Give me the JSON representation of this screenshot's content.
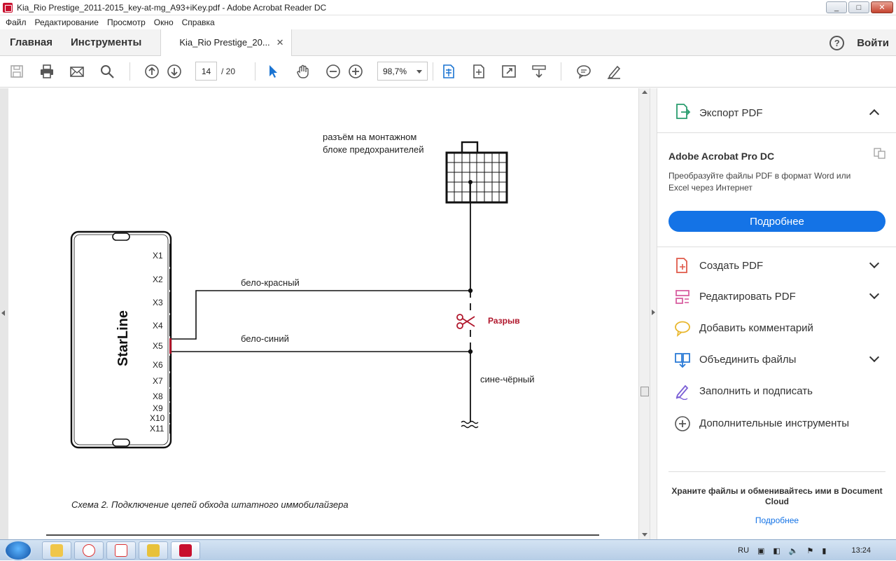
{
  "window": {
    "title": "Kia_Rio Prestige_2011-2015_key-at-mg_A93+iKey.pdf - Adobe Acrobat Reader DC",
    "min": "_",
    "max": "□",
    "close": "✕"
  },
  "menu": [
    "Файл",
    "Редактирование",
    "Просмотр",
    "Окно",
    "Справка"
  ],
  "tabs": {
    "home": "Главная",
    "tools": "Инструменты",
    "doc": "Kia_Rio Prestige_20...",
    "close": "✕",
    "signin": "Войти",
    "help": "?"
  },
  "toolbar": {
    "page_current": "14",
    "page_total": "/ 20",
    "zoom": "98,7%"
  },
  "diagram": {
    "connector_label_1": "разъём на монтажном",
    "connector_label_2": "блоке предохранителей",
    "brand": "StarLine",
    "ports": [
      "X1",
      "X2",
      "X3",
      "X4",
      "X5",
      "X6",
      "X7",
      "X8",
      "X9",
      "X10",
      "X11"
    ],
    "wire1": "бело-красный",
    "wire2": "бело-синий",
    "wire3": "сине-чёрный",
    "break_label": "Разрыв",
    "caption": "Схема 2.  Подключение цепей обхода штатного иммобилайзера"
  },
  "right_pane": {
    "export_pdf": "Экспорт PDF",
    "acrobat_title": "Adobe Acrobat Pro DC",
    "acrobat_desc": "Преобразуйте файлы PDF в формат Word или Excel через Интернет",
    "acrobat_btn": "Подробнее",
    "tools": [
      {
        "label": "Создать PDF"
      },
      {
        "label": "Редактировать PDF"
      },
      {
        "label": "Добавить комментарий"
      },
      {
        "label": "Объединить файлы"
      },
      {
        "label": "Заполнить и подписать"
      },
      {
        "label": "Дополнительные инструменты"
      }
    ],
    "cloud_title": "Храните файлы и обменивайтесь ими в Document Cloud",
    "cloud_link": "Подробнее"
  },
  "taskbar": {
    "lang": "RU",
    "time": "13:24"
  },
  "colors": {
    "accent": "#1473e6",
    "toolbar_blue": "#1b74d2",
    "break_red": "#b0162b"
  }
}
